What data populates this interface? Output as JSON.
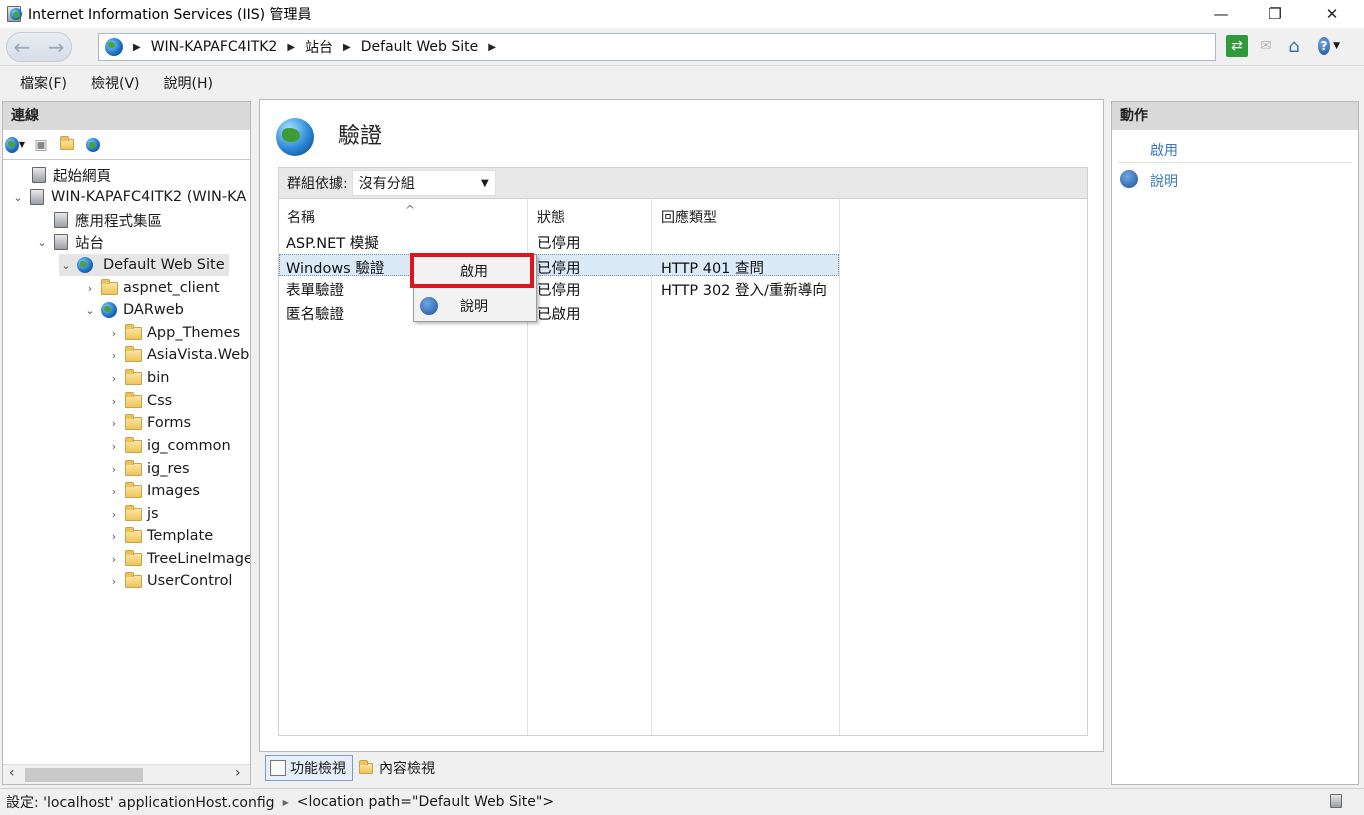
{
  "window": {
    "title": "Internet Information Services (IIS) 管理員",
    "minimize": "—",
    "maximize": "❐",
    "close": "✕"
  },
  "address": {
    "crumbs": [
      "WIN-KAPAFC4ITK2",
      "站台",
      "Default Web Site"
    ]
  },
  "menu": {
    "file": "檔案(F)",
    "view": "檢視(V)",
    "help": "說明(H)"
  },
  "connections": {
    "header": "連線",
    "tree": [
      {
        "label": "起始網頁",
        "icon": "start-page-icon"
      },
      {
        "label": "WIN-KAPAFC4ITK2 (WIN-KA",
        "icon": "server-icon"
      },
      {
        "label": "應用程式集區",
        "icon": "app-pool-icon"
      },
      {
        "label": "站台",
        "icon": "sites-icon"
      },
      {
        "label": "Default Web Site",
        "icon": "globe-icon"
      },
      {
        "label": "aspnet_client",
        "icon": "folder-icon"
      },
      {
        "label": "DARweb",
        "icon": "web-app-icon"
      },
      {
        "label": "App_Themes",
        "icon": "folder-icon"
      },
      {
        "label": "AsiaVista.Web",
        "icon": "folder-icon"
      },
      {
        "label": "bin",
        "icon": "folder-icon"
      },
      {
        "label": "Css",
        "icon": "folder-icon"
      },
      {
        "label": "Forms",
        "icon": "folder-icon"
      },
      {
        "label": "ig_common",
        "icon": "folder-icon"
      },
      {
        "label": "ig_res",
        "icon": "folder-icon"
      },
      {
        "label": "Images",
        "icon": "folder-icon"
      },
      {
        "label": "js",
        "icon": "folder-icon"
      },
      {
        "label": "Template",
        "icon": "folder-icon"
      },
      {
        "label": "TreeLineImage",
        "icon": "folder-icon"
      },
      {
        "label": "UserControl",
        "icon": "folder-icon"
      }
    ]
  },
  "feature": {
    "title": "驗證",
    "group_label": "群組依據:",
    "group_value": "沒有分組",
    "columns": [
      "名稱",
      "狀態",
      "回應類型"
    ],
    "rows": [
      {
        "name": "ASP.NET 模擬",
        "status": "已停用",
        "response": ""
      },
      {
        "name": "Windows 驗證",
        "status": "已停用",
        "response": "HTTP 401 查問"
      },
      {
        "name": "表單驗證",
        "status": "已停用",
        "response": "HTTP 302 登入/重新導向"
      },
      {
        "name": "匿名驗證",
        "status": "已啟用",
        "response": ""
      }
    ]
  },
  "context_menu": {
    "enable": "啟用",
    "help": "說明"
  },
  "view_tabs": {
    "features": "功能檢視",
    "content": "內容檢視"
  },
  "actions": {
    "header": "動作",
    "enable": "啟用",
    "help": "說明"
  },
  "status": {
    "config": "設定: 'localhost' applicationHost.config",
    "location": "<location path=\"Default Web Site\">"
  }
}
